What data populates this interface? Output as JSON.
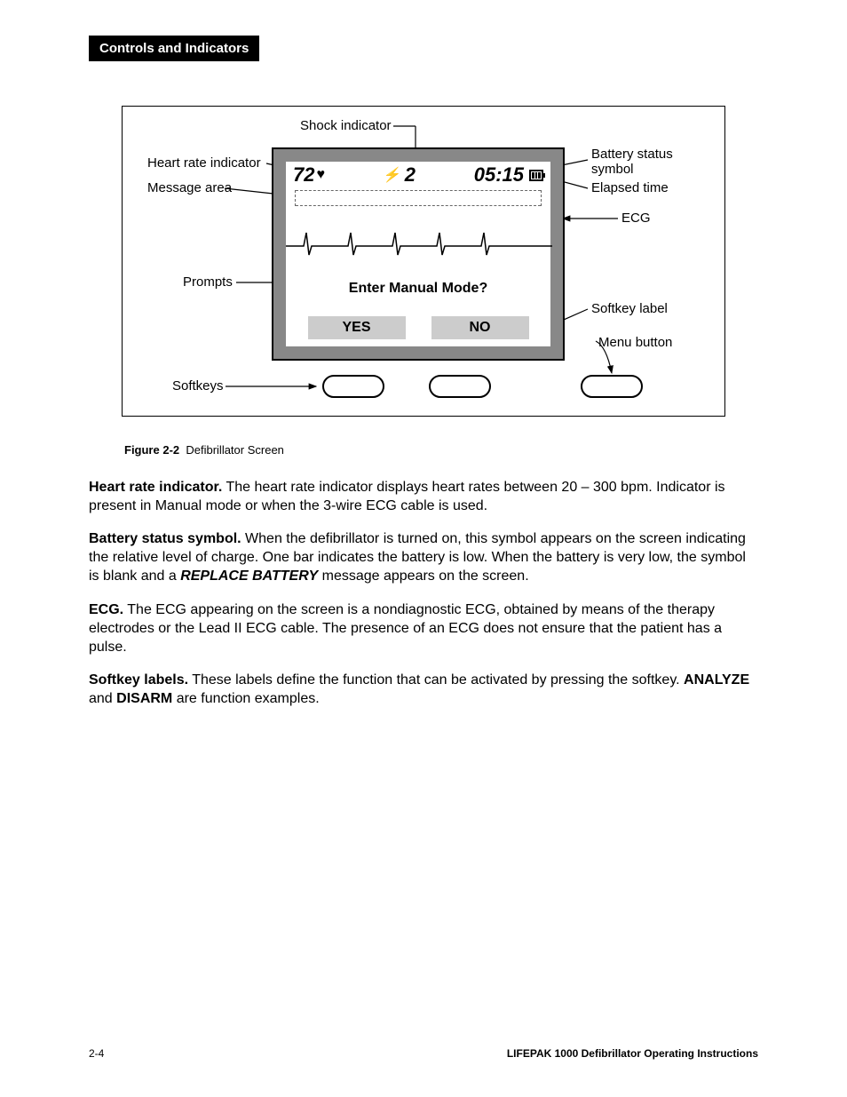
{
  "header": {
    "section_title": "Controls and Indicators"
  },
  "diagram": {
    "labels": {
      "heart_rate_indicator": "Heart rate indicator",
      "shock_indicator": "Shock indicator",
      "battery_status_symbol": "Battery status symbol",
      "message_area": "Message area",
      "elapsed_time": "Elapsed time",
      "ecg": "ECG",
      "prompts": "Prompts",
      "softkey_label": "Softkey label",
      "menu_button": "Menu button",
      "softkeys": "Softkeys"
    },
    "screen": {
      "heart_rate_value": "72",
      "shock_count": "2",
      "elapsed_time": "05:15",
      "prompt_text": "Enter Manual Mode?",
      "softkey_yes": "YES",
      "softkey_no": "NO"
    }
  },
  "caption": {
    "prefix": "Figure 2-2",
    "text": "Defibrillator Screen"
  },
  "paragraphs": {
    "p1_bold": "Heart rate indicator.",
    "p1_text": " The heart rate indicator displays heart rates between 20 – 300 bpm. Indicator is present in Manual mode or when the 3-wire ECG cable is used.",
    "p2_bold": "Battery status symbol.",
    "p2_text_a": " When the defibrillator is turned on, this symbol appears on the screen indicating the relative level of charge. One bar indicates the battery is low. When the battery is very low, the symbol is blank and a ",
    "p2_cmd": "REPLACE BATTERY",
    "p2_text_b": " message appears on the screen.",
    "p3_bold": "ECG.",
    "p3_text": " The ECG appearing on the screen is a nondiagnostic ECG, obtained by means of the therapy electrodes or the Lead II ECG cable. The presence of an ECG does not ensure that the patient has a pulse.",
    "p4_bold": "Softkey labels.",
    "p4_text_a": " These labels define the function that can be activated by pressing the softkey. ",
    "p4_kw1": "ANALYZE",
    "p4_mid": " and ",
    "p4_kw2": "DISARM",
    "p4_text_b": " are function examples."
  },
  "footer": {
    "page_num": "2-4",
    "doc_title": "LIFEPAK 1000 Defibrillator Operating Instructions"
  }
}
